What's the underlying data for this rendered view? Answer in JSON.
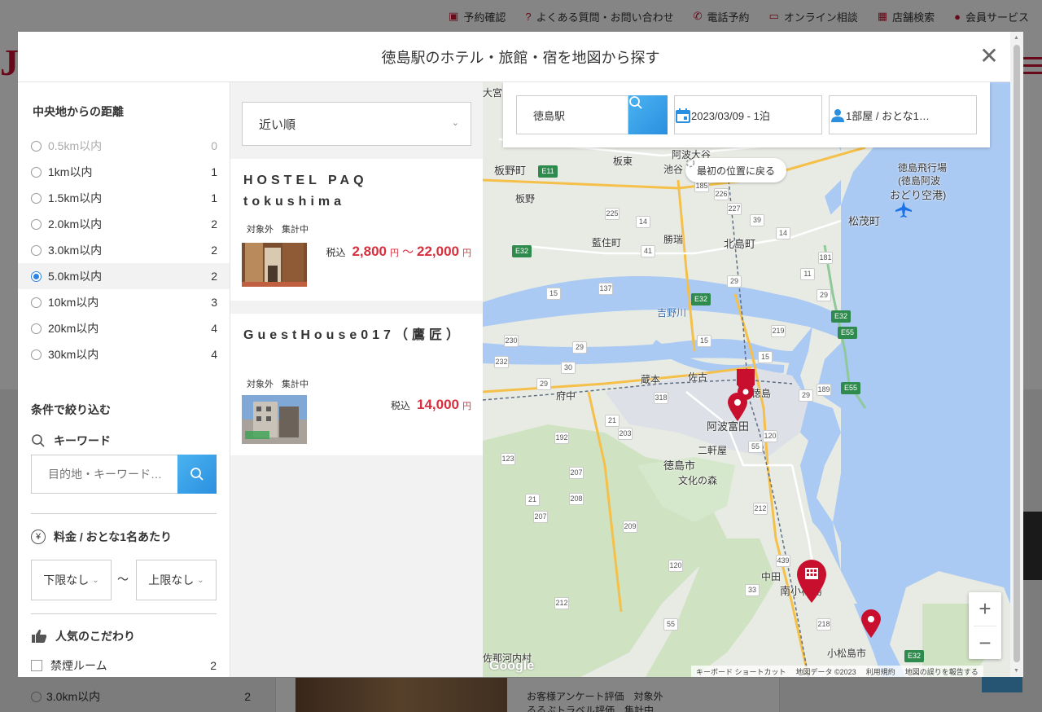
{
  "bg": {
    "nav": [
      {
        "icon": "briefcase-icon",
        "glyph": "▣",
        "label": "予約確認"
      },
      {
        "icon": "question-icon",
        "glyph": "?",
        "label": "よくある質問・お問い合わせ"
      },
      {
        "icon": "phone-icon",
        "glyph": "✆",
        "label": "電話予約"
      },
      {
        "icon": "monitor-icon",
        "glyph": "▭",
        "label": "オンライン相談"
      },
      {
        "icon": "store-icon",
        "glyph": "▦",
        "label": "店舗検索"
      },
      {
        "icon": "user-icon",
        "glyph": "●",
        "label": "会員サービス"
      }
    ],
    "left_row": {
      "label": "3.0km以内",
      "count": "2"
    },
    "card_lines": [
      {
        "a": "お客様アンケート評価",
        "b": "対象外"
      },
      {
        "a": "るるぶトラベル評価",
        "b": "集計中"
      }
    ]
  },
  "modal": {
    "title": "徳島駅のホテル・旅館・宿を地図から探す",
    "close_glyph": "✕"
  },
  "sidebar": {
    "distance_title": "中央地からの距離",
    "distances": [
      {
        "label": "0.5km以内",
        "count": "0",
        "state": "disabled"
      },
      {
        "label": "1km以内",
        "count": "1",
        "state": ""
      },
      {
        "label": "1.5km以内",
        "count": "1",
        "state": ""
      },
      {
        "label": "2.0km以内",
        "count": "2",
        "state": ""
      },
      {
        "label": "3.0km以内",
        "count": "2",
        "state": ""
      },
      {
        "label": "5.0km以内",
        "count": "2",
        "state": "selected"
      },
      {
        "label": "10km以内",
        "count": "3",
        "state": ""
      },
      {
        "label": "20km以内",
        "count": "4",
        "state": ""
      },
      {
        "label": "30km以内",
        "count": "4",
        "state": ""
      }
    ],
    "filter_title": "条件で絞り込む",
    "keyword_label": "キーワード",
    "keyword_placeholder": "目的地・キーワード…",
    "price_label": "料金 / おとな1名あたり",
    "price_min": "下限なし",
    "price_max": "上限なし",
    "tilde": "〜",
    "popular_label": "人気のこだわり",
    "checkbox_label": "禁煙ルーム",
    "checkbox_count": "2"
  },
  "list": {
    "sort_label": "近い順",
    "hotels": [
      {
        "name": "HOSTEL PAQ tokushima",
        "tags": [
          "対象外",
          "集計中"
        ],
        "tax": "税込",
        "price_min": "2,800",
        "price_max": "22,000",
        "yen": "円",
        "sep": "～"
      },
      {
        "name": "GuestHouse017（鷹匠）",
        "tags": [
          "対象外",
          "集計中"
        ],
        "tax": "税込",
        "price": "14,000",
        "yen": "円"
      }
    ]
  },
  "map": {
    "location": "徳島駅",
    "date": "2023/03/09 - 1泊",
    "rooms": "1部屋 / おとな1…",
    "reset_label": "最初の位置に戻る",
    "zoom_in": "+",
    "zoom_out": "−",
    "google": "Google",
    "attribution": [
      "キーボード ショートカット",
      "地図データ ©2023",
      "利用規約",
      "地図の誤りを報告する"
    ],
    "places": [
      "板野町",
      "板東",
      "阿波大谷",
      "池谷",
      "板野",
      "徳島飛行場",
      "(徳島阿波",
      "おどり空港)",
      "藍住町",
      "北島町",
      "松茂町",
      "勝瑞",
      "吉野川",
      "府中",
      "蔵本",
      "佐古",
      "徳島",
      "阿波富田",
      "二軒屋",
      "徳島市",
      "文化の森",
      "中田",
      "南小松島",
      "小松島市",
      "佐那河内村",
      "大宮"
    ],
    "routes": [
      "E11",
      "185",
      "226",
      "227",
      "225",
      "14",
      "39",
      "14",
      "181",
      "E32",
      "137",
      "41",
      "29",
      "11",
      "29",
      "15",
      "E32",
      "E32",
      "219",
      "15",
      "E55",
      "230",
      "29",
      "15",
      "232",
      "29",
      "30",
      "318",
      "29",
      "189",
      "E55",
      "21",
      "203",
      "120",
      "192",
      "55",
      "123",
      "207",
      "208",
      "212",
      "21",
      "207",
      "209",
      "120",
      "439",
      "212",
      "33",
      "55",
      "218",
      "E32"
    ],
    "brand_color": "#c8102e",
    "accent_color": "#2b8fe0"
  }
}
